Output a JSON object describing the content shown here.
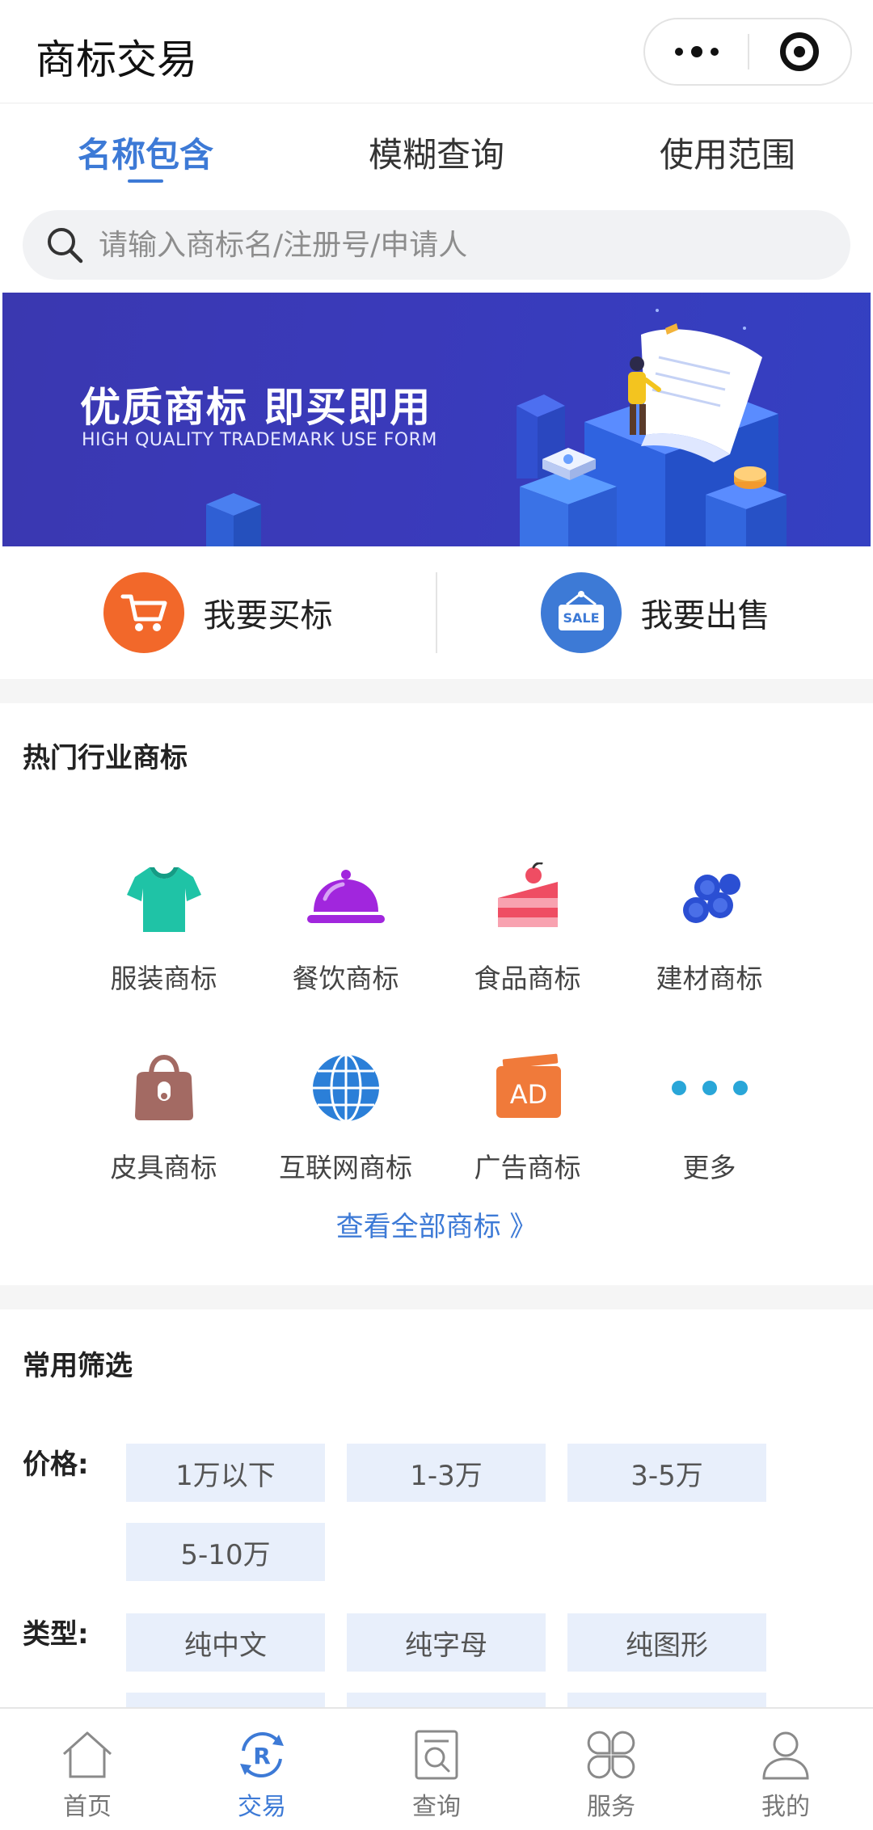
{
  "header": {
    "title": "商标交易"
  },
  "tabs": [
    {
      "label": "名称包含",
      "active": true
    },
    {
      "label": "模糊查询",
      "active": false
    },
    {
      "label": "使用范围",
      "active": false
    }
  ],
  "search": {
    "placeholder": "请输入商标名/注册号/申请人"
  },
  "banner": {
    "title": "优质商标  即买即用",
    "subtitle": "HIGH QUALITY TRADEMARK USE FORM"
  },
  "actions": [
    {
      "label": "我要买标",
      "icon": "cart-icon",
      "color": "#f2682a"
    },
    {
      "label": "我要出售",
      "icon": "sale-tag-icon",
      "color": "#3d7ad6",
      "icon_text": "SALE"
    }
  ],
  "hot": {
    "title": "热门行业商标",
    "items": [
      {
        "label": "服装商标",
        "icon": "tshirt-icon",
        "color": "#1fc3a6"
      },
      {
        "label": "餐饮商标",
        "icon": "food-cloche-icon",
        "color": "#a126dd"
      },
      {
        "label": "食品商标",
        "icon": "cake-icon",
        "color": "#ef4d63"
      },
      {
        "label": "建材商标",
        "icon": "pipes-icon",
        "color": "#2b4fd3"
      },
      {
        "label": "皮具商标",
        "icon": "leather-bag-icon",
        "color": "#a36a63"
      },
      {
        "label": "互联网商标",
        "icon": "globe-icon",
        "color": "#2b7fd8"
      },
      {
        "label": "广告商标",
        "icon": "ad-icon",
        "color": "#f07a3a",
        "icon_text": "AD"
      },
      {
        "label": "更多",
        "icon": "more-dots-icon",
        "color": "#29a6d8"
      }
    ],
    "view_all": "查看全部商标 》"
  },
  "filters": {
    "title": "常用筛选",
    "price_label": "价格:",
    "price_options": [
      "1万以下",
      "1-3万",
      "3-5万",
      "5-10万"
    ],
    "type_label": "类型:",
    "type_options": [
      "纯中文",
      "纯字母",
      "纯图形"
    ]
  },
  "bottom_nav": [
    {
      "label": "首页",
      "icon": "home-icon",
      "active": false
    },
    {
      "label": "交易",
      "icon": "trade-r-icon",
      "active": true,
      "icon_text": "R"
    },
    {
      "label": "查询",
      "icon": "query-icon",
      "active": false
    },
    {
      "label": "服务",
      "icon": "service-grid-icon",
      "active": false
    },
    {
      "label": "我的",
      "icon": "user-icon",
      "active": false
    }
  ],
  "colors": {
    "accent": "#3d7ad6",
    "chip_bg": "#e8effb",
    "banner_bg": "#3a3aba"
  }
}
